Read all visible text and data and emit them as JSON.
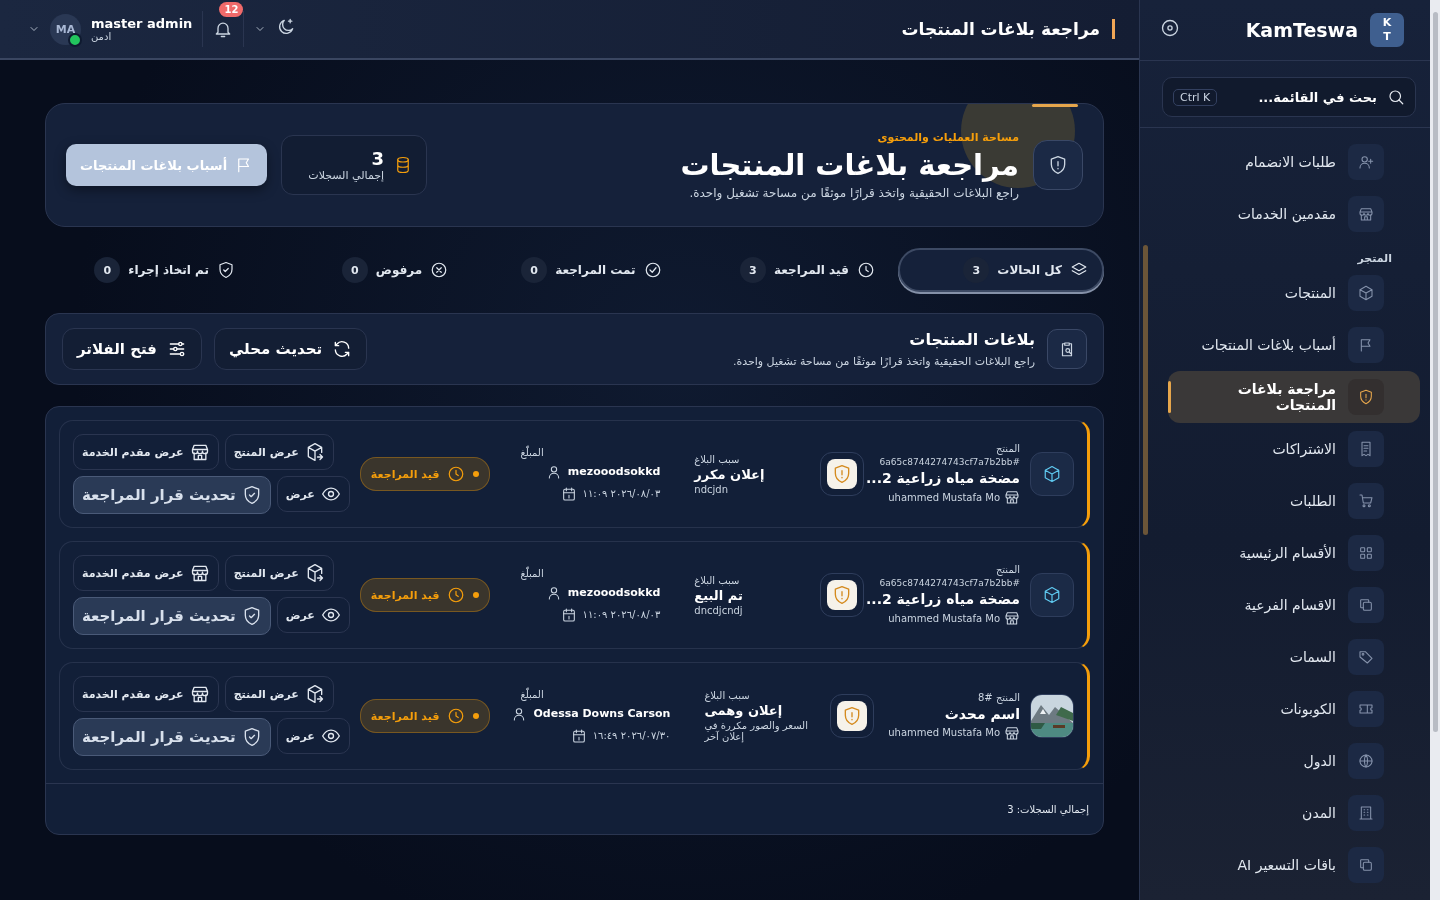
{
  "sidebar": {
    "brand": {
      "logo": [
        "K",
        "T"
      ],
      "name": "KamTeswa"
    },
    "search": {
      "placeholder": "بحث في القائمة...",
      "shortcut": "Ctrl K"
    },
    "groups": [
      {
        "items": [
          {
            "label": "طلبات الانضمام",
            "selected": false
          },
          {
            "label": "مقدمين الخدمات",
            "selected": false
          }
        ]
      },
      {
        "title": "المتجر",
        "items": [
          {
            "label": "المنتجات",
            "selected": false
          },
          {
            "label": "أسباب بلاغات المنتجات",
            "selected": false
          },
          {
            "label": "مراجعة بلاغات المنتجات",
            "selected": true
          },
          {
            "label": "الاشتراكات",
            "selected": false
          },
          {
            "label": "الطلبات",
            "selected": false
          },
          {
            "label": "الأقسام الرئيسية",
            "selected": false
          },
          {
            "label": "الاقسام الفرعية",
            "selected": false
          },
          {
            "label": "السمات",
            "selected": false
          },
          {
            "label": "الكوبونات",
            "selected": false
          },
          {
            "label": "الدول",
            "selected": false
          },
          {
            "label": "المدن",
            "selected": false
          },
          {
            "label": "باقات التسعير AI",
            "selected": false
          }
        ]
      }
    ]
  },
  "topbar": {
    "title": "مراجعة بلاغات المنتجات",
    "user": {
      "initials": "MA",
      "name": "master admin",
      "role": "ادمن",
      "online": true
    },
    "notifications": "12"
  },
  "hero": {
    "eyebrow": "مساحة العمليات والمحتوى",
    "title": "مراجعة بلاغات المنتجات",
    "subtitle": "راجع البلاغات الحقيقية واتخذ قرارًا موثقًا من مساحة تشغيل واحدة.",
    "stat": {
      "value": "3",
      "label": "إجمالي السجلات"
    },
    "button": "أسباب بلاغات المنتجات"
  },
  "tabs": [
    {
      "label": "كل الحالات",
      "count": "3",
      "selected": true
    },
    {
      "label": "قيد المراجعة",
      "count": "3",
      "selected": false
    },
    {
      "label": "تمت المراجعة",
      "count": "0",
      "selected": false
    },
    {
      "label": "مرفوض",
      "count": "0",
      "selected": false
    },
    {
      "label": "تم اتخاذ إجراء",
      "count": "0",
      "selected": false
    }
  ],
  "list_header": {
    "title": "بلاغات المنتجات",
    "subtitle": "راجع البلاغات الحقيقية واتخذ قرارًا موثقًا من مساحة تشغيل واحدة.",
    "buttons": [
      "تحديث محلي",
      "فتح الفلاتر"
    ]
  },
  "reports": [
    {
      "kind": "icon",
      "product_label": "المنتج",
      "product_id": "6a65c8744274743cf7a7b2bb#",
      "product_name": "مضخة مياه زراعية 2...",
      "provider": "uhammed Mustafa Mo",
      "reason_label": "سبب البلاغ",
      "reason": "إعلان مكرر",
      "reason_detail": "ndcjdn",
      "reporter_label": "المبلّغ",
      "reporter": "mezooodsokkd",
      "date": "٢٠٢٦/٠٨/٠٣ ١١:٠٩",
      "status": {
        "label": "قيد المراجعة",
        "kind": "pending"
      },
      "actions": [
        {
          "label": "عرض المنتج",
          "kind": "product"
        },
        {
          "label": "عرض مقدم الخدمة",
          "kind": "provider"
        },
        {
          "label": "عرض",
          "kind": "view"
        },
        {
          "label": "تحديث قرار المراجعة",
          "kind": "decision"
        }
      ]
    },
    {
      "kind": "icon",
      "product_label": "المنتج",
      "product_id": "6a65c8744274743cf7a7b2bb#",
      "product_name": "مضخة مياه زراعية 2...",
      "provider": "uhammed Mustafa Mo",
      "reason_label": "سبب البلاغ",
      "reason": "تم البيع",
      "reason_detail": "dncdjcndj",
      "reporter_label": "المبلّغ",
      "reporter": "mezooodsokkd",
      "date": "٢٠٢٦/٠٨/٠٣ ١١:٠٩",
      "status": {
        "label": "قيد المراجعة",
        "kind": "pending"
      },
      "actions": [
        {
          "label": "عرض المنتج",
          "kind": "product"
        },
        {
          "label": "عرض مقدم الخدمة",
          "kind": "provider"
        },
        {
          "label": "عرض",
          "kind": "view"
        },
        {
          "label": "تحديث قرار المراجعة",
          "kind": "decision"
        }
      ]
    },
    {
      "kind": "picture",
      "product_label": "المنتج #8",
      "product_name": "اسم محدث",
      "provider": "uhammed Mustafa Mo",
      "reason_label": "سبب البلاغ",
      "reason": "إعلان وهمى",
      "reason_detail": "السعر والصور مكررة في إعلان آخر",
      "reporter_label": "المبلّغ",
      "reporter": "Odessa Downs Carson",
      "date": "٢٠٢٦/٠٧/٣٠ ١٦:٤٩",
      "status": {
        "label": "قيد المراجعة",
        "kind": "pending"
      },
      "actions": [
        {
          "label": "عرض المنتج",
          "kind": "product"
        },
        {
          "label": "عرض مقدم الخدمة",
          "kind": "provider"
        },
        {
          "label": "عرض",
          "kind": "view"
        },
        {
          "label": "تحديث قرار المراجعة",
          "kind": "decision"
        }
      ]
    }
  ],
  "footer": "إجمالي السجلات: 3"
}
